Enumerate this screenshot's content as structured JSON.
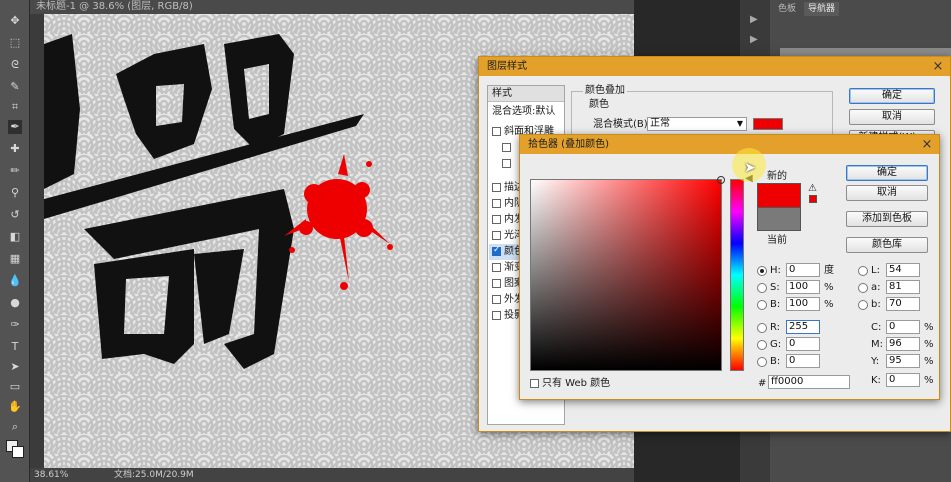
{
  "document_tab": {
    "title": "未标题-1 @ 38.6% (图层, RGB/8)"
  },
  "status_bar": {
    "zoom": "38.61%",
    "doc_size": "文档:25.0M/20.9M"
  },
  "right_panel": {
    "tabs": [
      "色板",
      "导航器"
    ]
  },
  "canvas": {
    "artwork_text": "圈",
    "pattern_color": "#c8c8c8",
    "splash_color": "#ee0000"
  },
  "layer_style_dialog": {
    "title": "图层样式",
    "styles_header": "样式",
    "blend_options": "混合选项:默认",
    "items": [
      {
        "label": "斜面和浮雕",
        "checked": false
      },
      {
        "label": "描边",
        "checked": false
      },
      {
        "label": "内阴影",
        "checked": false
      },
      {
        "label": "内发光",
        "checked": false
      },
      {
        "label": "光泽",
        "checked": false
      },
      {
        "label": "颜色叠加",
        "checked": true
      },
      {
        "label": "渐变叠加",
        "checked": false
      },
      {
        "label": "图案叠加",
        "checked": false
      },
      {
        "label": "外发光",
        "checked": false
      },
      {
        "label": "投影",
        "checked": false
      }
    ],
    "group_title": "颜色叠加",
    "subgroup_title": "颜色",
    "blend_mode_label": "混合模式(B):",
    "blend_mode_value": "正常",
    "overlay_color": "#ee0000",
    "ok_label": "确定",
    "cancel_label": "取消",
    "new_style_label": "新建样式(W)..."
  },
  "color_picker": {
    "title": "拾色器 (叠加颜色)",
    "new_label": "新的",
    "current_label": "当前",
    "new_color": "#ee0000",
    "current_color": "#7a7a7a",
    "ok_label": "确定",
    "cancel_label": "取消",
    "add_swatch_label": "添加到色板",
    "color_library_label": "颜色库",
    "hsb": [
      {
        "key": "H:",
        "value": "0",
        "unit": "度"
      },
      {
        "key": "S:",
        "value": "100",
        "unit": "%"
      },
      {
        "key": "B:",
        "value": "100",
        "unit": "%"
      }
    ],
    "rgb": [
      {
        "key": "R:",
        "value": "255"
      },
      {
        "key": "G:",
        "value": "0"
      },
      {
        "key": "B:",
        "value": "0"
      }
    ],
    "lab": [
      {
        "key": "L:",
        "value": "54"
      },
      {
        "key": "a:",
        "value": "81"
      },
      {
        "key": "b:",
        "value": "70"
      }
    ],
    "cmyk": [
      {
        "key": "C:",
        "value": "0",
        "unit": "%"
      },
      {
        "key": "M:",
        "value": "96",
        "unit": "%"
      },
      {
        "key": "Y:",
        "value": "95",
        "unit": "%"
      },
      {
        "key": "K:",
        "value": "0",
        "unit": "%"
      }
    ],
    "hex_label": "#",
    "hex_value": "ff0000",
    "web_only_label": "只有 Web 颜色",
    "web_only_checked": false
  }
}
